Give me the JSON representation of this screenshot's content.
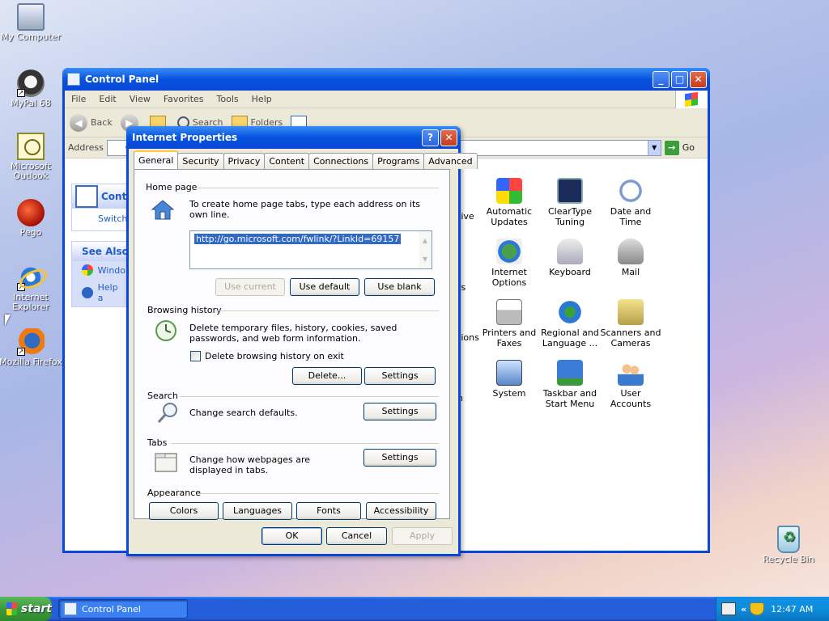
{
  "desktop": {
    "icons": [
      {
        "label": "My Computer"
      },
      {
        "label": "MyPal 68"
      },
      {
        "label": "Microsoft Outlook"
      },
      {
        "label": "Pego"
      },
      {
        "label": "Internet Explorer"
      },
      {
        "label": "Mozilla Firefox"
      },
      {
        "label": "Recycle Bin"
      }
    ]
  },
  "control_panel": {
    "title": "Control Panel",
    "menu": [
      "File",
      "Edit",
      "View",
      "Favorites",
      "Tools",
      "Help"
    ],
    "toolbar": {
      "back": "Back",
      "search": "Search",
      "folders": "Folders"
    },
    "address_label": "Address",
    "address_value": "C",
    "go_label": "Go",
    "left_pane": {
      "task_title": "Contr",
      "task_link": "Switch",
      "see_also": "See Also",
      "see_also_items": [
        "Windo",
        "Help a"
      ]
    },
    "partials": [
      "tive",
      "rs",
      "tions",
      "n"
    ],
    "items": [
      {
        "label": "Automatic Updates"
      },
      {
        "label": "ClearType Tuning"
      },
      {
        "label": "Date and Time"
      },
      {
        "label": "Internet Options"
      },
      {
        "label": "Keyboard"
      },
      {
        "label": "Mail"
      },
      {
        "label": "Printers and Faxes"
      },
      {
        "label": "Regional and Language ..."
      },
      {
        "label": "Scanners and Cameras"
      },
      {
        "label": "System"
      },
      {
        "label": "Taskbar and Start Menu"
      },
      {
        "label": "User Accounts"
      }
    ]
  },
  "dialog": {
    "title": "Internet Properties",
    "help_button": "?",
    "close_button": "✕",
    "tabs": [
      "General",
      "Security",
      "Privacy",
      "Content",
      "Connections",
      "Programs",
      "Advanced"
    ],
    "home_page": {
      "label": "Home page",
      "description": "To create home page tabs, type each address on its own line.",
      "url": "http://go.microsoft.com/fwlink/?LinkId=69157",
      "use_current": "Use current",
      "use_default": "Use default",
      "use_blank": "Use blank"
    },
    "browsing_history": {
      "label": "Browsing history",
      "description": "Delete temporary files, history, cookies, saved passwords, and web form information.",
      "checkbox_label": "Delete browsing history on exit",
      "delete_button": "Delete...",
      "settings_button": "Settings"
    },
    "search": {
      "label": "Search",
      "description": "Change search defaults.",
      "settings_button": "Settings"
    },
    "tabs_section": {
      "label": "Tabs",
      "description": "Change how webpages are displayed in tabs.",
      "settings_button": "Settings"
    },
    "appearance": {
      "label": "Appearance",
      "buttons": [
        "Colors",
        "Languages",
        "Fonts",
        "Accessibility"
      ]
    },
    "ok": "OK",
    "cancel": "Cancel",
    "apply": "Apply"
  },
  "taskbar": {
    "start": "start",
    "window_button": "Control Panel",
    "tray_chevron": "«",
    "clock": "12:47 AM"
  }
}
